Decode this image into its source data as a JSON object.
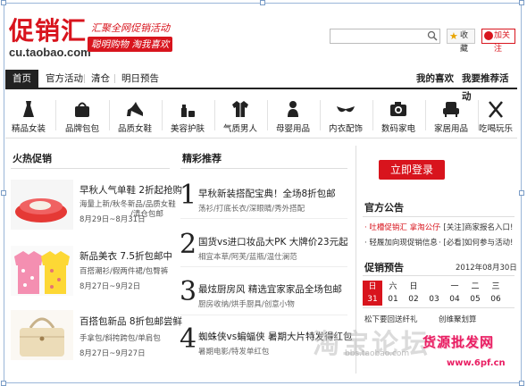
{
  "header": {
    "logo_text": "促销汇",
    "logo_url": "cu.taobao.com",
    "tagline": "汇聚全网促销活动",
    "tagline_badge": "聪明购物 淘我喜欢",
    "fav_label": "收藏",
    "follow_label": "加关注"
  },
  "nav": {
    "tabs": [
      {
        "label": "首页"
      },
      {
        "label": "官方活动"
      },
      {
        "label": "清仓"
      },
      {
        "label": "明日预告"
      }
    ],
    "right": [
      "我的喜欢",
      "我要推荐活动"
    ]
  },
  "categories": [
    {
      "label": "精品女装",
      "icon": "dress-icon"
    },
    {
      "label": "品牌包包",
      "icon": "handbag-icon"
    },
    {
      "label": "品质女鞋",
      "icon": "heel-shoe-icon"
    },
    {
      "label": "美容护肤",
      "icon": "cosmetics-icon"
    },
    {
      "label": "气质男人",
      "icon": "shirt-icon"
    },
    {
      "label": "母婴用品",
      "icon": "baby-icon"
    },
    {
      "label": "内衣配饰",
      "icon": "bra-icon"
    },
    {
      "label": "数码家电",
      "icon": "camera-icon"
    },
    {
      "label": "家居用品",
      "icon": "sofa-icon"
    },
    {
      "label": "吃喝玩乐",
      "icon": "cutlery-icon"
    }
  ],
  "hot": {
    "title": "火热促销",
    "items": [
      {
        "title": "早秋人气单鞋 2折起抢购",
        "sub1": "海量上新/秋冬新品/品质女鞋",
        "sub2": "/清仓包邮",
        "date": "8月29日~8月31日"
      },
      {
        "title": "新品美衣 7.5折包邮中",
        "sub1": "百搭潮衫/假两件裙/包臀裤",
        "sub2": "",
        "date": "8月27日~9月2日"
      },
      {
        "title": "百搭包新品 8折包邮尝鲜",
        "sub1": "手拿包/斜挎跨包/单肩包",
        "sub2": "",
        "date": "8月27日~9月27日"
      }
    ]
  },
  "rec": {
    "title": "精彩推荐",
    "items": [
      {
        "num": "1",
        "title": "早秋新装搭配宝典！全场8折包邮",
        "sub": "荡衫/打底长衣/深眼睛/秀外搭配"
      },
      {
        "num": "2",
        "title": "国货vs进口妆品大PK 大牌价23元起",
        "sub": "相宜本草/阿芙/蓝瓶/温仕澜范"
      },
      {
        "num": "3",
        "title": "最炫厨房风 精选宜家家品全场包邮",
        "sub": "厨房收纳/烘手厨具/创意小物"
      },
      {
        "num": "4",
        "title": "蜘蛛侠vs蝙蝠侠 暑期大片特发得红包",
        "sub": "暑期电影/特发单红包"
      }
    ]
  },
  "side": {
    "login_label": "立即登录",
    "notice_title": "官方公告",
    "notices": [
      {
        "text": "· 吐槽促销汇 拿淘公仔",
        "color": "#d8141d"
      },
      {
        "text": "· [关注]商家报名入口!",
        "color": "#333"
      },
      {
        "text": "· 轻履加向现促销信息",
        "color": "#333"
      },
      {
        "text": "· [必看]如何参与活动!",
        "color": "#333"
      }
    ],
    "preview_title": "促销预告",
    "preview_date": "2012年08月30日",
    "week_days": [
      "日",
      "六",
      "日",
      "一",
      "二",
      "三"
    ],
    "dates": [
      "31",
      "01",
      "02",
      "03",
      "04",
      "05",
      "06"
    ],
    "preview_items": [
      "松下要回送纤礼",
      "创维聚划算"
    ]
  },
  "overlay": {
    "watermark": "淘宝论坛",
    "watermark_url": "bbs.taobao.com",
    "promo": "货源批发网",
    "promo_url": "www.6pf.cn"
  },
  "colors": {
    "brand": "#d8141d",
    "nav_bg": "#222222"
  }
}
